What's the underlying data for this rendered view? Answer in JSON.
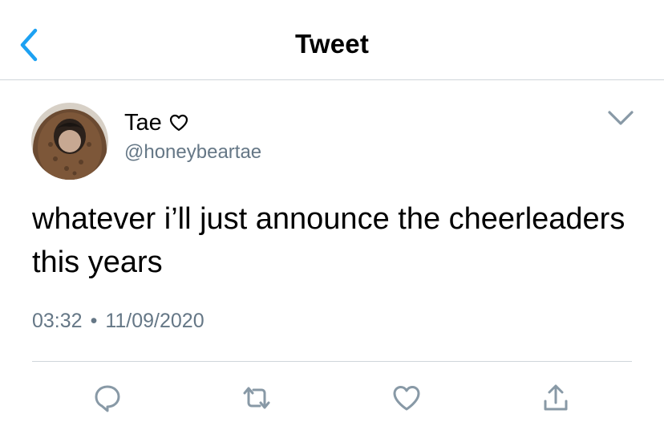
{
  "header": {
    "title": "Tweet",
    "back_icon": "chevron-left-icon"
  },
  "tweet": {
    "author": {
      "name": "Tae",
      "name_emoji_icon": "white-heart-icon",
      "handle": "@honeybeartae",
      "avatar_icon": "avatar-photo"
    },
    "more_icon": "chevron-down-icon",
    "text": "whatever i’ll just announce the cheerleaders this years",
    "time": "03:32",
    "separator": "•",
    "date": "11/09/2020"
  },
  "actions": [
    {
      "icon": "reply-icon"
    },
    {
      "icon": "retweet-icon"
    },
    {
      "icon": "like-icon"
    },
    {
      "icon": "share-icon"
    }
  ],
  "colors": {
    "accent": "#1da1f2",
    "secondary_text": "#657786",
    "icon_gray": "#8899a6",
    "divider": "#cfd5da"
  }
}
